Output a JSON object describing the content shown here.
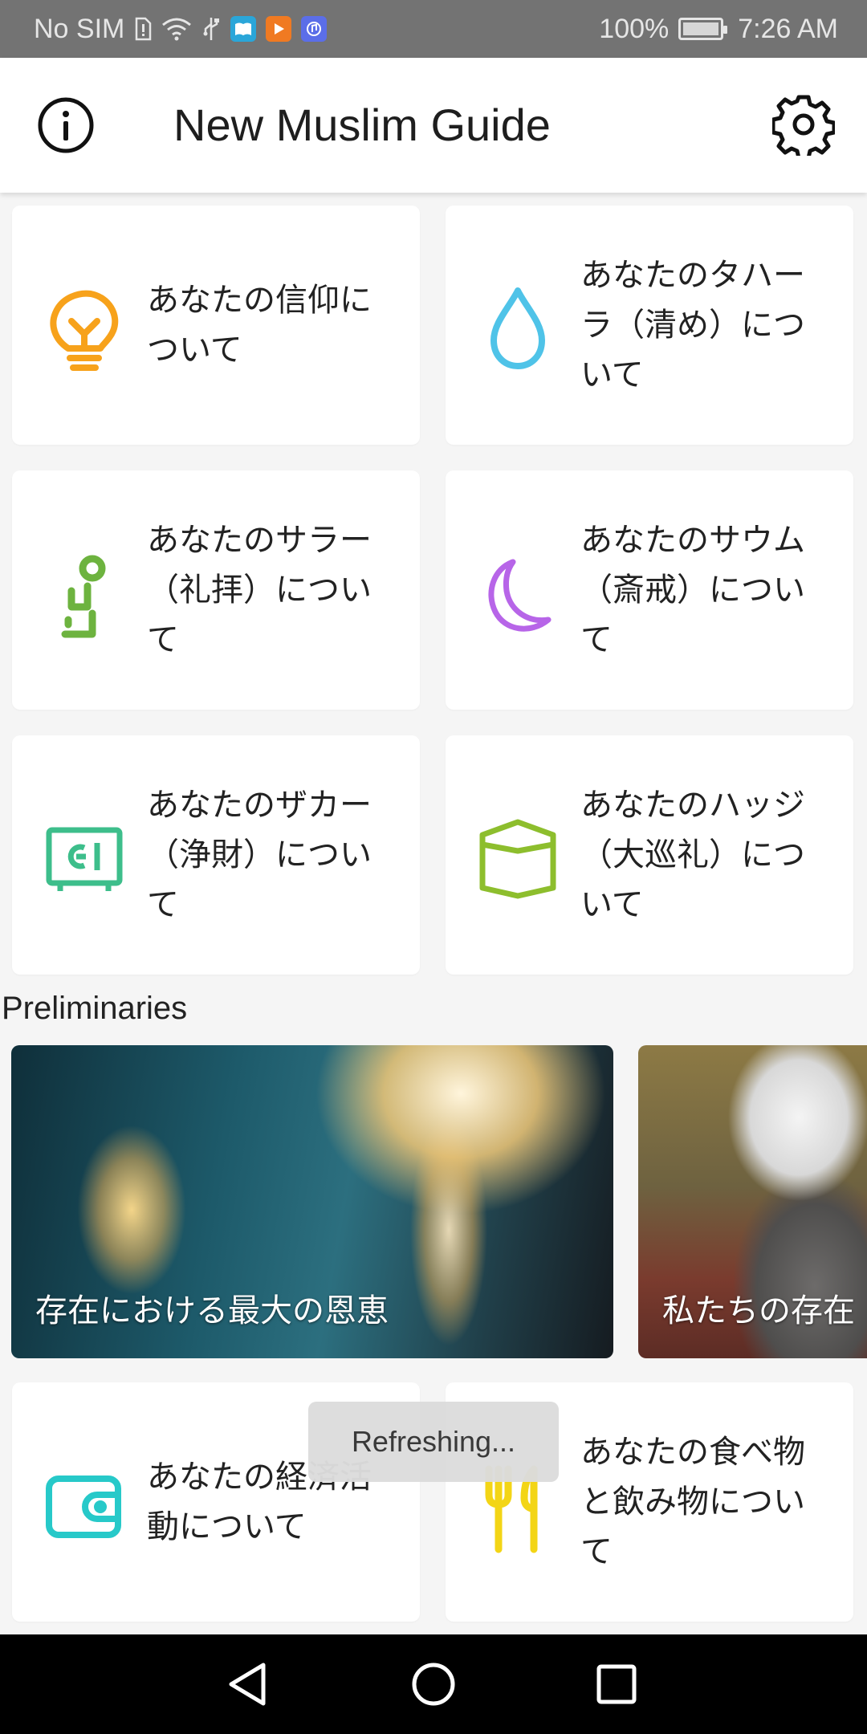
{
  "status_bar": {
    "carrier": "No SIM",
    "battery": "100%",
    "time": "7:26 AM",
    "icons": [
      "sim-alert-icon",
      "wifi-icon",
      "usb-icon",
      "book-app-icon",
      "video-app-icon",
      "music-app-icon",
      "battery-charging-icon"
    ]
  },
  "app_bar": {
    "title": "New Muslim Guide",
    "info_icon": "info-icon",
    "settings_icon": "gear-icon"
  },
  "categories": [
    {
      "label": "あなたの信仰について",
      "icon": "lightbulb-icon",
      "color": "#F7A21B"
    },
    {
      "label": "あなたのタハーラ（清め）について",
      "icon": "water-drop-icon",
      "color": "#4FC3E8"
    },
    {
      "label": "あなたのサラー（礼拝）について",
      "icon": "prayer-icon",
      "color": "#6DB33F"
    },
    {
      "label": "あなたのサウム（斎戒）について",
      "icon": "crescent-moon-icon",
      "color": "#B765E8"
    },
    {
      "label": "あなたのザカー（浄財）について",
      "icon": "safe-icon",
      "color": "#3DBE8B"
    },
    {
      "label": "あなたのハッジ（大巡礼）について",
      "icon": "kaaba-icon",
      "color": "#8DBE2D"
    },
    {
      "label": "あなたの経済活動について",
      "icon": "wallet-icon",
      "color": "#27C9C9"
    },
    {
      "label": "あなたの食べ物と飲み物について",
      "icon": "cutlery-icon",
      "color": "#F3D516"
    }
  ],
  "preliminaries": {
    "title": "Preliminaries",
    "slides": [
      {
        "caption": "存在における最大の恩恵"
      },
      {
        "caption": "私たちの存在"
      }
    ]
  },
  "toast": {
    "text": "Refreshing..."
  },
  "nav_bar": {
    "icons": [
      "back-icon",
      "home-icon",
      "recents-icon"
    ]
  }
}
